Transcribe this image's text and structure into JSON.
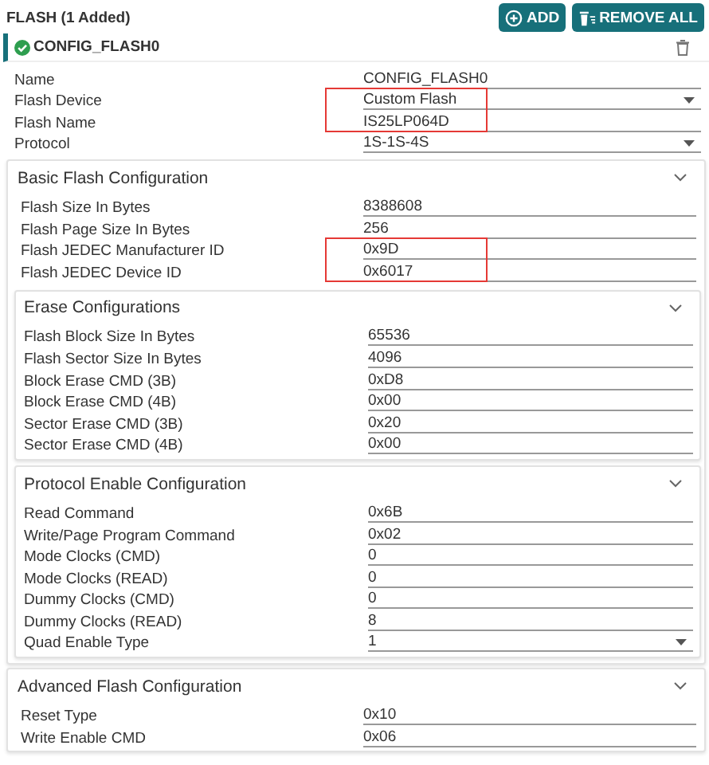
{
  "header": {
    "title": "FLASH (1 Added)",
    "buttons": [
      {
        "kind": "add",
        "label": "ADD"
      },
      {
        "kind": "remove",
        "label": "REMOVE ALL"
      }
    ]
  },
  "instance": {
    "title": "CONFIG_FLASH0",
    "valid": true
  },
  "fields": [
    {
      "label": "Name",
      "value": "CONFIG_FLASH0",
      "kind": "text",
      "highlighted": false
    },
    {
      "label": "Flash Device",
      "value": "Custom Flash",
      "kind": "select",
      "highlighted": true
    },
    {
      "label": "Flash Name",
      "value": "IS25LP064D",
      "kind": "text",
      "highlighted": true
    },
    {
      "label": "Protocol",
      "value": "1S-1S-4S",
      "kind": "select",
      "highlighted": false
    }
  ],
  "sections": [
    {
      "title": "Basic Flash Configuration",
      "expanded": true,
      "fields": [
        {
          "label": "Flash Size In Bytes",
          "value": "8388608",
          "kind": "text",
          "highlighted": false
        },
        {
          "label": "Flash Page Size In Bytes",
          "value": "256",
          "kind": "text",
          "highlighted": false
        },
        {
          "label": "Flash JEDEC Manufacturer ID",
          "value": "0x9D",
          "kind": "text",
          "highlighted": true
        },
        {
          "label": "Flash JEDEC Device ID",
          "value": "0x6017",
          "kind": "text",
          "highlighted": true
        }
      ],
      "subsections": [
        {
          "title": "Erase Configurations",
          "expanded": true,
          "fields": [
            {
              "label": "Flash Block Size In Bytes",
              "value": "65536",
              "kind": "text",
              "highlighted": false
            },
            {
              "label": "Flash Sector Size In Bytes",
              "value": "4096",
              "kind": "text",
              "highlighted": false
            },
            {
              "label": "Block Erase CMD (3B)",
              "value": "0xD8",
              "kind": "text",
              "highlighted": false
            },
            {
              "label": "Block Erase CMD (4B)",
              "value": "0x00",
              "kind": "text",
              "highlighted": false
            },
            {
              "label": "Sector Erase CMD (3B)",
              "value": "0x20",
              "kind": "text",
              "highlighted": false
            },
            {
              "label": "Sector Erase CMD (4B)",
              "value": "0x00",
              "kind": "text",
              "highlighted": false
            }
          ]
        },
        {
          "title": "Protocol Enable Configuration",
          "expanded": true,
          "fields": [
            {
              "label": "Read Command",
              "value": "0x6B",
              "kind": "text",
              "highlighted": false
            },
            {
              "label": "Write/Page Program Command",
              "value": "0x02",
              "kind": "text",
              "highlighted": false
            },
            {
              "label": "Mode Clocks (CMD)",
              "value": "0",
              "kind": "text",
              "highlighted": false
            },
            {
              "label": "Mode Clocks (READ)",
              "value": "0",
              "kind": "text",
              "highlighted": false
            },
            {
              "label": "Dummy Clocks (CMD)",
              "value": "0",
              "kind": "text",
              "highlighted": false
            },
            {
              "label": "Dummy Clocks (READ)",
              "value": "8",
              "kind": "text",
              "highlighted": false
            },
            {
              "label": "Quad Enable Type",
              "value": "1",
              "kind": "select",
              "highlighted": false
            }
          ]
        }
      ]
    },
    {
      "title": "Advanced Flash Configuration",
      "expanded": true,
      "fields": [
        {
          "label": "Reset Type",
          "value": "0x10",
          "kind": "text",
          "highlighted": false
        },
        {
          "label": "Write Enable CMD",
          "value": "0x06",
          "kind": "text",
          "highlighted": false
        }
      ]
    }
  ]
}
